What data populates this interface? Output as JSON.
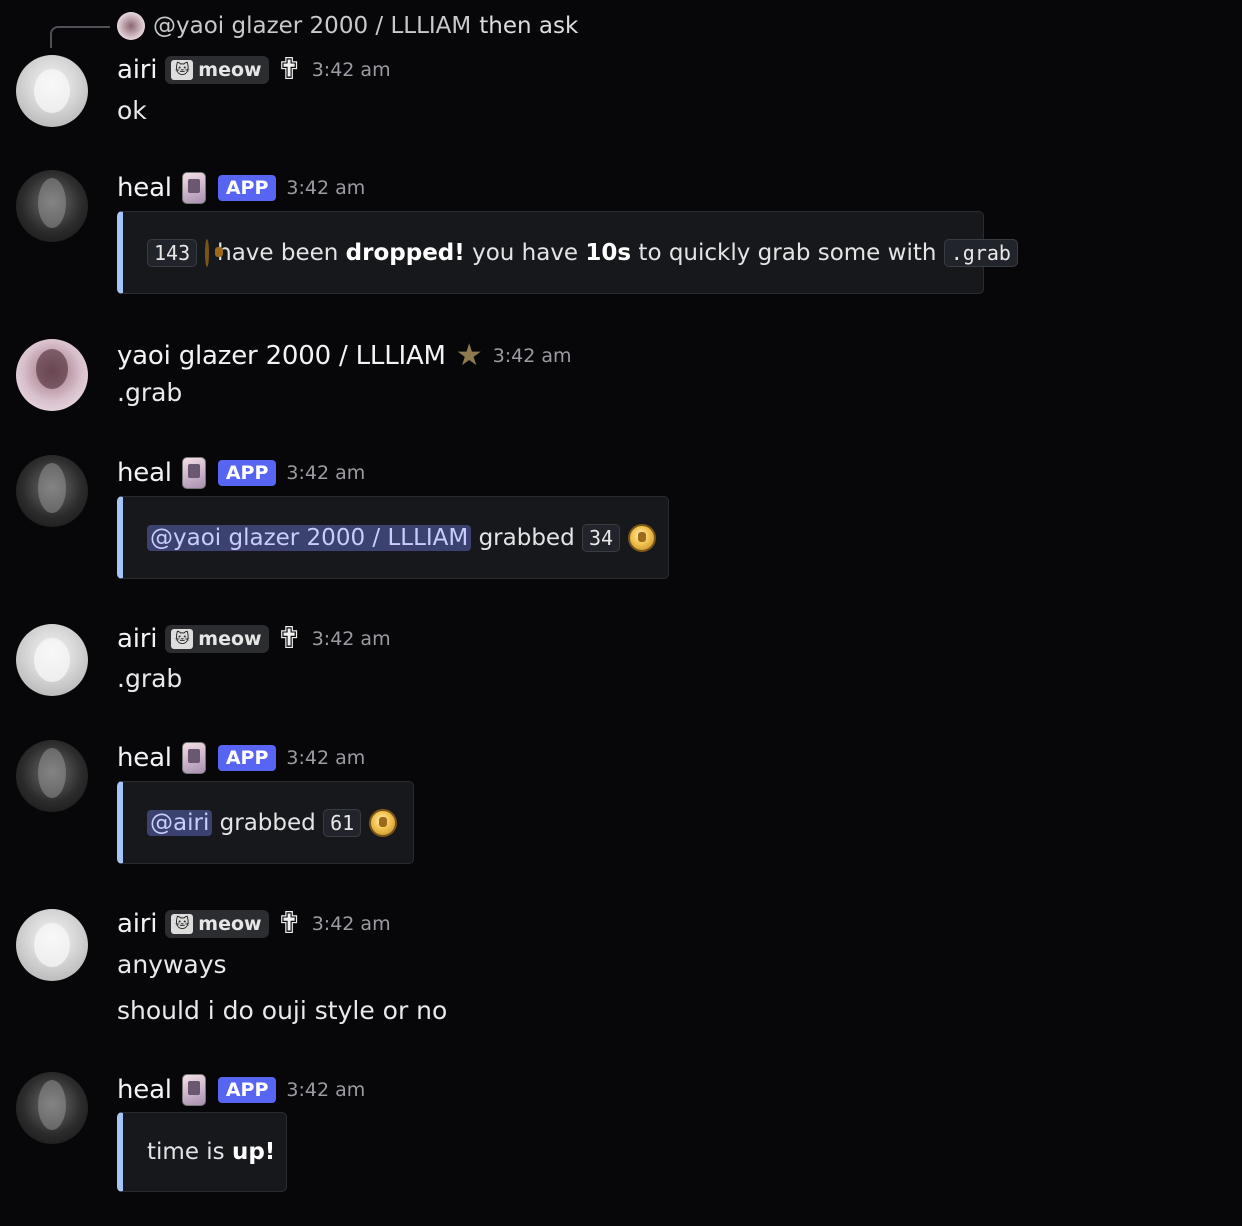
{
  "reply": {
    "author": "@yaoi glazer 2000 / LLLIAM",
    "text": "then ask"
  },
  "messages": [
    {
      "author": "airi",
      "tag": "meow",
      "tag_icon": "cat-face-icon",
      "icon": "winged-cross-icon",
      "time": "3:42 am",
      "lines": [
        "ok"
      ]
    },
    {
      "author": "heal",
      "icon": "flip-phone-icon",
      "badge": "APP",
      "time": "3:42 am",
      "embed": {
        "count": "143",
        "text1": "have been",
        "bold1": "dropped!",
        "text2": "you have",
        "bold2": "10s",
        "text3": "to quickly grab some with",
        "command": ".grab"
      }
    },
    {
      "author": "yaoi glazer 2000 / LLLIAM",
      "icon": "star-icon",
      "time": "3:42 am",
      "lines": [
        ".grab"
      ]
    },
    {
      "author": "heal",
      "icon": "flip-phone-icon",
      "badge": "APP",
      "time": "3:42 am",
      "embed": {
        "mention": "@yaoi glazer 2000 / LLLIAM",
        "text": "grabbed",
        "amount": "34"
      }
    },
    {
      "author": "airi",
      "tag": "meow",
      "tag_icon": "cat-face-icon",
      "icon": "winged-cross-icon",
      "time": "3:42 am",
      "lines": [
        ".grab"
      ]
    },
    {
      "author": "heal",
      "icon": "flip-phone-icon",
      "badge": "APP",
      "time": "3:42 am",
      "embed": {
        "mention": "@airi",
        "text": "grabbed",
        "amount": "61"
      }
    },
    {
      "author": "airi",
      "tag": "meow",
      "tag_icon": "cat-face-icon",
      "icon": "winged-cross-icon",
      "time": "3:42 am",
      "lines": [
        "anyways",
        "should i do ouji style or no"
      ]
    },
    {
      "author": "heal",
      "icon": "flip-phone-icon",
      "badge": "APP",
      "time": "3:42 am",
      "embed": {
        "text": "time is",
        "bold": "up!"
      }
    }
  ],
  "colors": {
    "background": "#070709",
    "app_badge": "#5865f2",
    "embed_border": "#a6c4f5",
    "mention_bg": "#3c4270"
  }
}
